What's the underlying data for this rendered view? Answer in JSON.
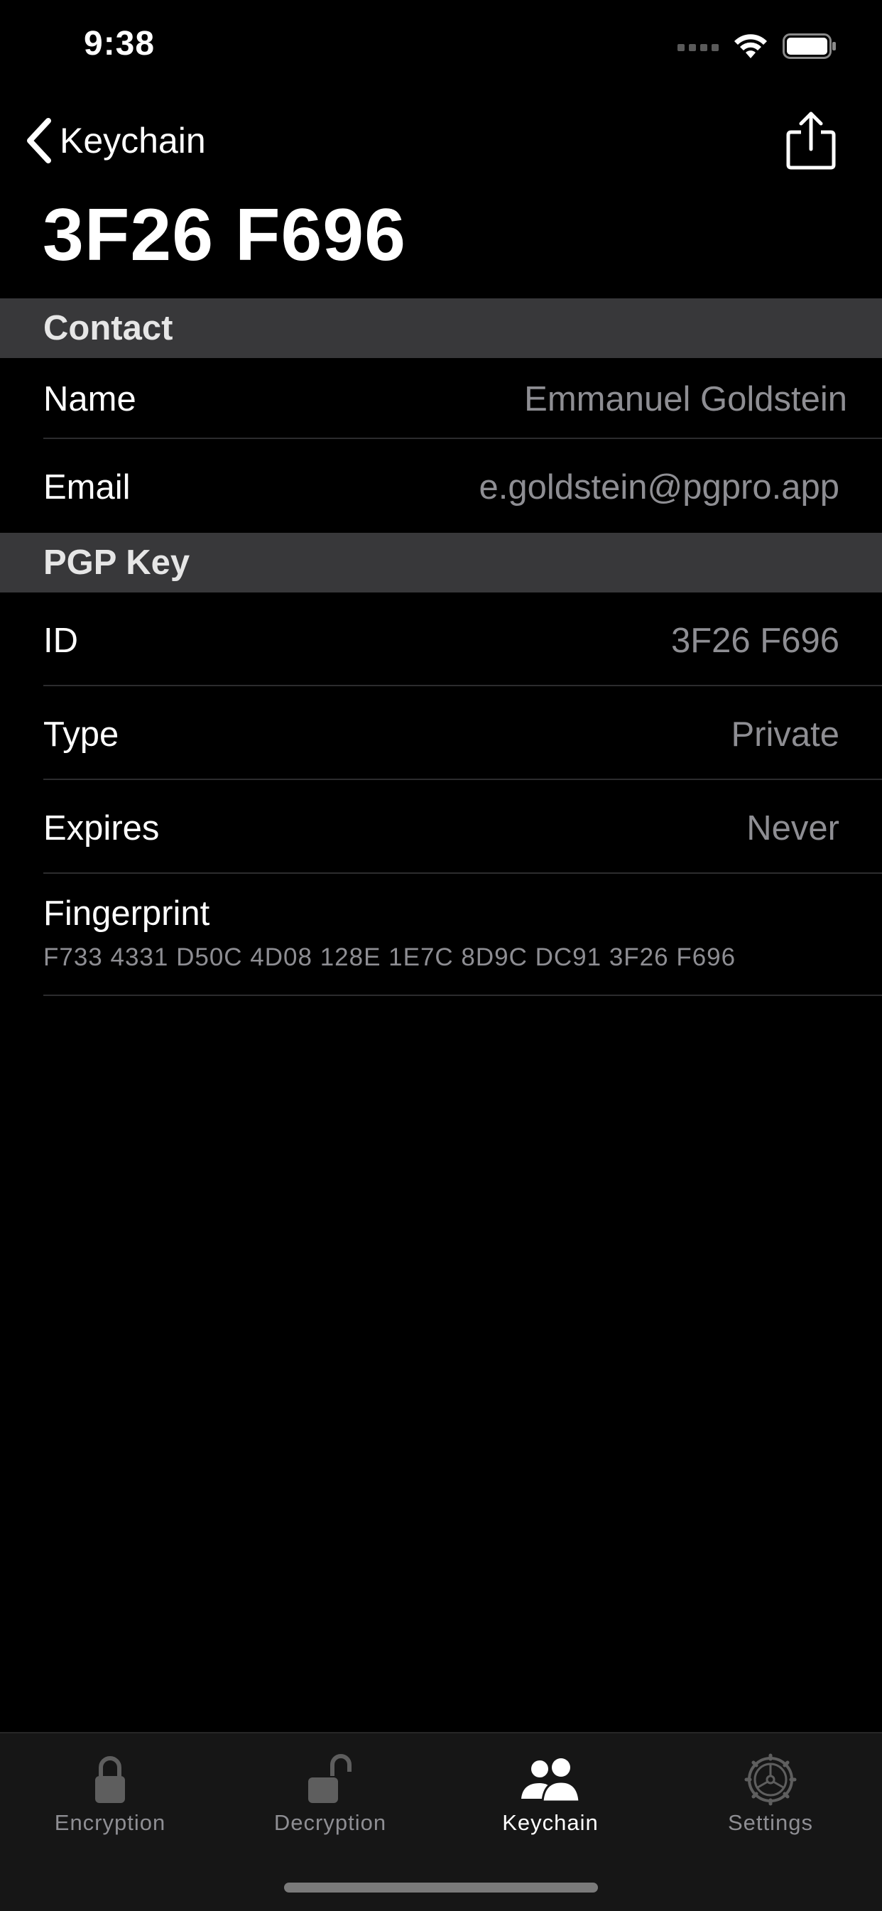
{
  "status_bar": {
    "time": "9:38"
  },
  "nav": {
    "back_label": "Keychain",
    "back_icon": "chevron-left-icon",
    "share_icon": "share-icon"
  },
  "page": {
    "title": "3F26 F696"
  },
  "sections": {
    "contact": {
      "header": "Contact",
      "name_label": "Name",
      "name_value": "Emmanuel Goldstein",
      "email_label": "Email",
      "email_value": "e.goldstein@pgpro.app"
    },
    "pgp_key": {
      "header": "PGP Key",
      "id_label": "ID",
      "id_value": "3F26 F696",
      "type_label": "Type",
      "type_value": "Private",
      "expires_label": "Expires",
      "expires_value": "Never",
      "fingerprint_label": "Fingerprint",
      "fingerprint_value": "F733 4331 D50C 4D08 128E 1E7C 8D9C DC91 3F26 F696"
    }
  },
  "tab_bar": {
    "tabs": [
      {
        "label": "Encryption",
        "icon": "lock-icon",
        "active": false
      },
      {
        "label": "Decryption",
        "icon": "unlock-icon",
        "active": false
      },
      {
        "label": "Keychain",
        "icon": "people-icon",
        "active": true
      },
      {
        "label": "Settings",
        "icon": "gear-icon",
        "active": false
      }
    ]
  },
  "colors": {
    "background": "#000000",
    "section_header": "#38383a",
    "secondary_text": "#8e8e93",
    "tab_bar": "#161616"
  }
}
